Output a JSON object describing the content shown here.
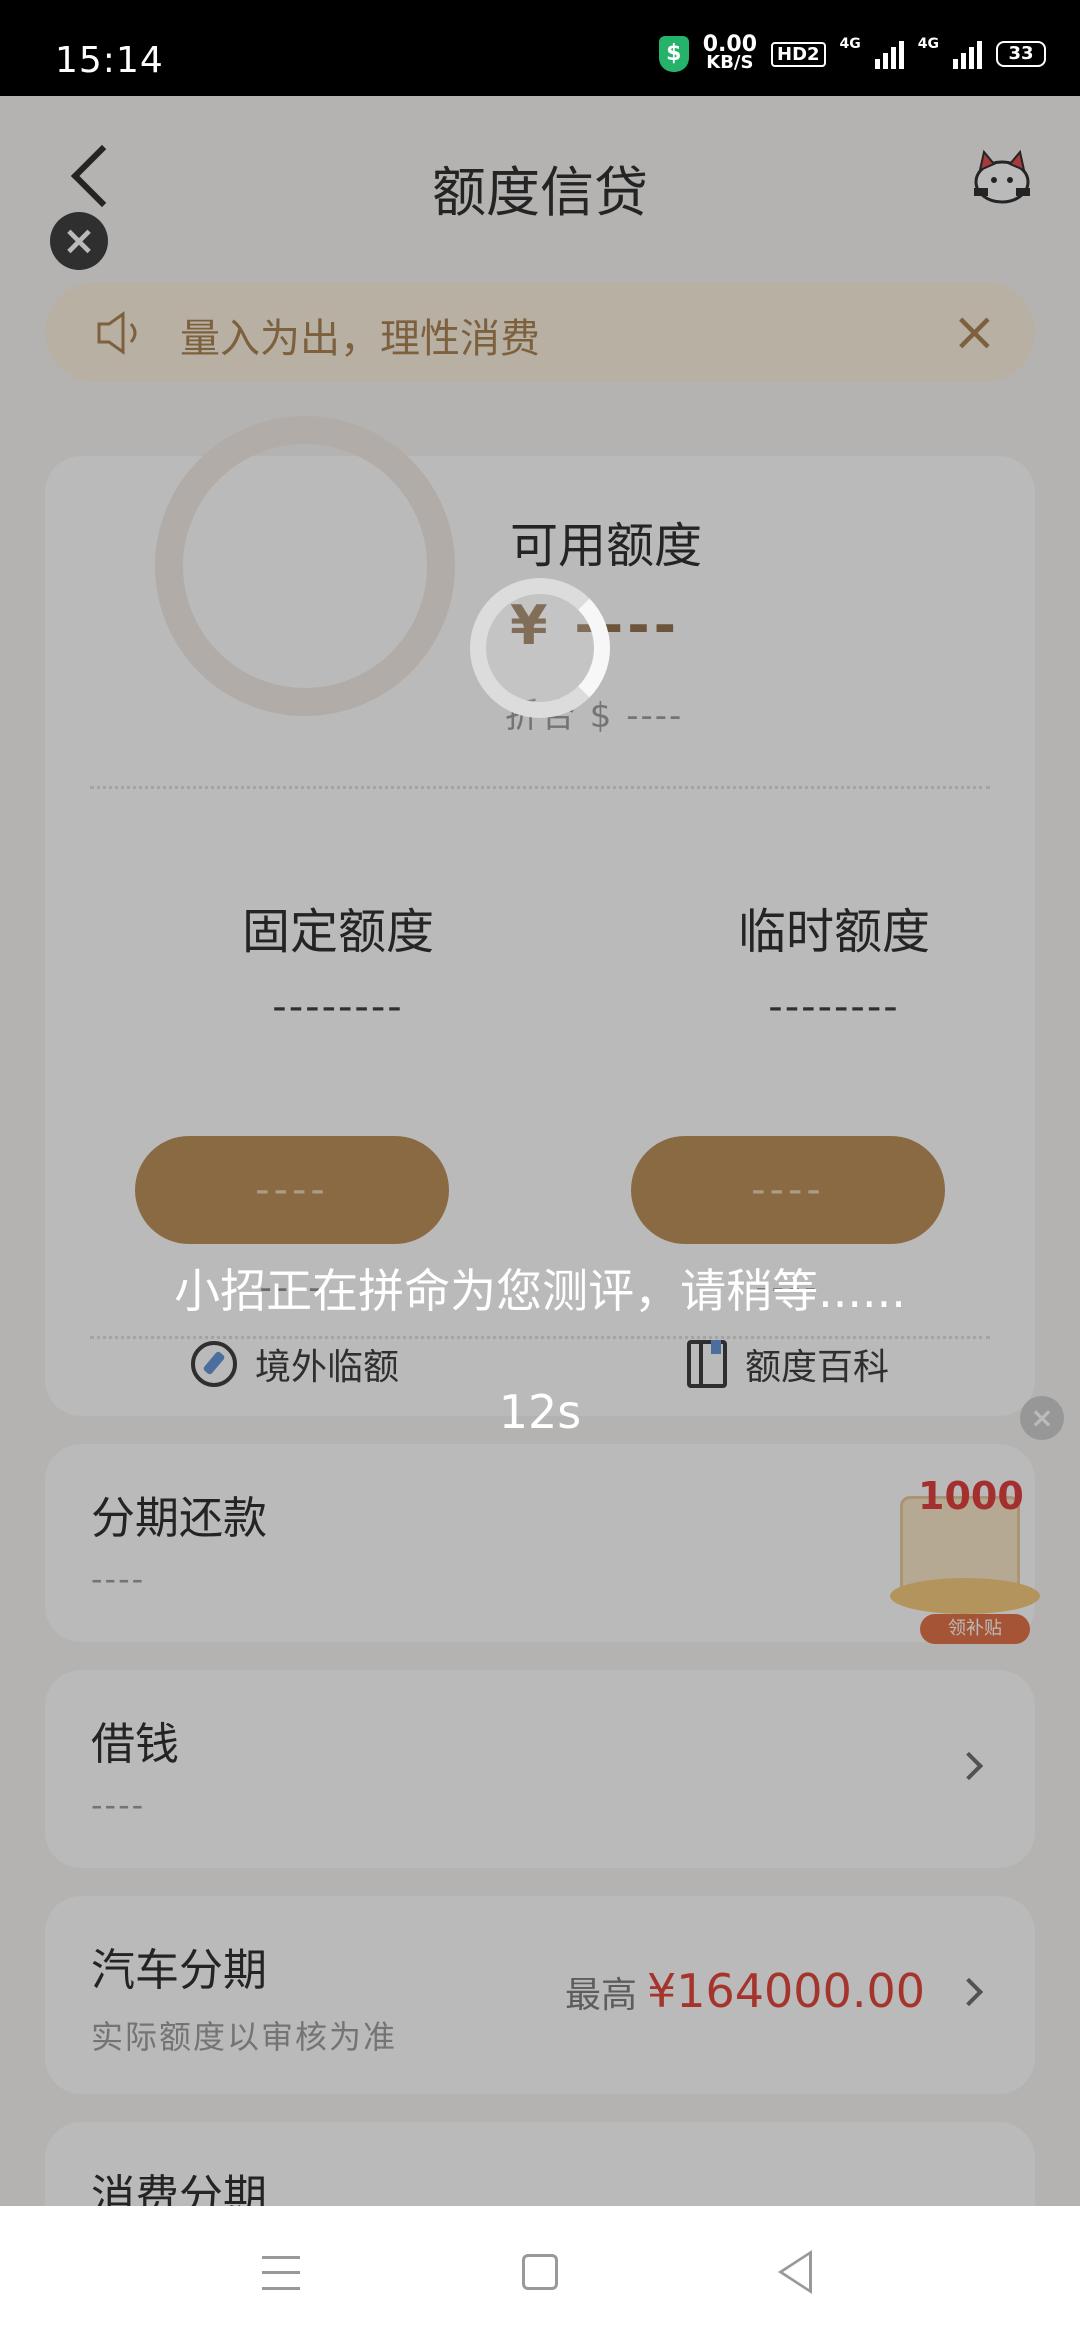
{
  "status_bar": {
    "time": "15:14",
    "speed_value": "0.00",
    "speed_unit": "KB/S",
    "hd_label": "HD2",
    "network1": "4G",
    "network2": "4G",
    "battery": "33"
  },
  "nav": {
    "title": "额度信贷",
    "back_icon": "chevron-left-icon",
    "mascot_icon": "mascot-cat-icon"
  },
  "notice": {
    "text": "量入为出，理性消费"
  },
  "credit": {
    "available_label": "可用额度",
    "available_amount": "¥ ----",
    "available_sub": "折合 $ ----",
    "fixed_label": "固定额度",
    "fixed_value": "--------",
    "temp_label": "临时额度",
    "temp_value": "--------",
    "fixed_button": "----",
    "temp_button": "----",
    "fixed_foot": "----",
    "temp_foot": "----",
    "link_overseas": "境外临额",
    "link_wiki": "额度百科"
  },
  "rows": [
    {
      "title": "分期还款",
      "sub": "----"
    },
    {
      "title": "借钱",
      "sub": "----"
    },
    {
      "title": "汽车分期",
      "sub": "实际额度以审核为准",
      "right_label": "最高",
      "right_price": "¥164000.00"
    },
    {
      "title": "消费分期"
    }
  ],
  "promo": {
    "amount": "1000",
    "label": "领补贴"
  },
  "overlay": {
    "message": "小招正在拼命为您测评，请稍等......",
    "countdown": "12s"
  }
}
